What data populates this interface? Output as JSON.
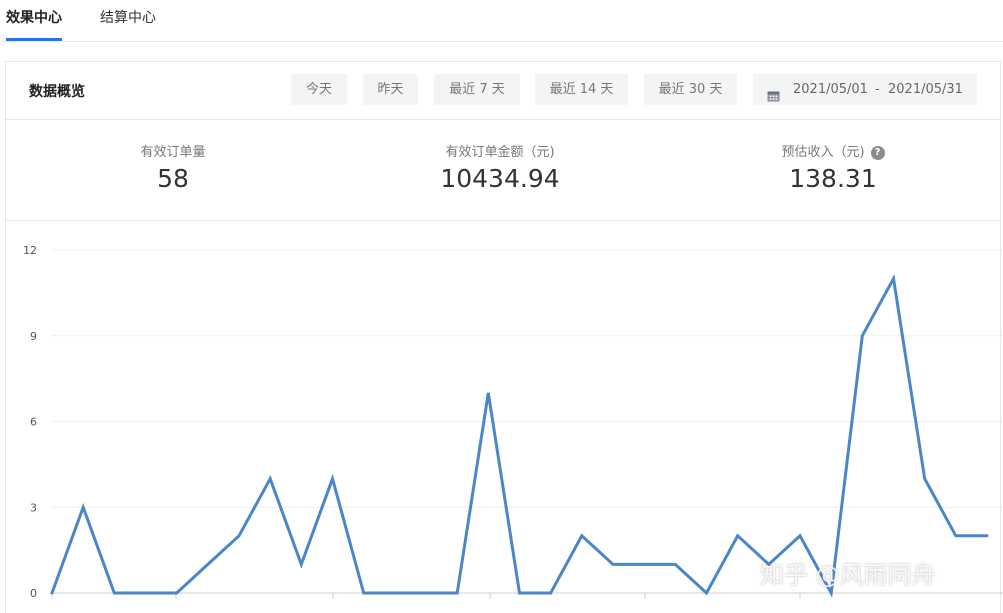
{
  "tabs": [
    {
      "label": "效果中心",
      "active": true
    },
    {
      "label": "结算中心",
      "active": false
    }
  ],
  "overview": {
    "title": "数据概览",
    "ranges": [
      "今天",
      "昨天",
      "最近 7 天",
      "最近 14 天",
      "最近 30 天"
    ],
    "date_range": {
      "icon": "calendar-icon",
      "start": "2021/05/01",
      "separator": "-",
      "end": "2021/05/31"
    }
  },
  "metrics": [
    {
      "label": "有效订单量",
      "value": "58"
    },
    {
      "label": "有效订单金额（元)",
      "value": "10434.94"
    },
    {
      "label": "预估收入（元)",
      "value": "138.31",
      "help_icon": "question-circle-icon",
      "help_glyph": "?"
    }
  ],
  "chart_data": {
    "type": "line",
    "x": [
      1,
      2,
      3,
      4,
      5,
      6,
      7,
      8,
      9,
      10,
      11,
      12,
      13,
      14,
      15,
      16,
      17,
      18,
      19,
      20,
      21,
      22,
      23,
      24,
      25,
      26,
      27,
      28,
      29,
      30,
      31
    ],
    "series": [
      {
        "values": [
          0,
          3,
          0,
          0,
          0,
          1,
          2,
          4,
          1,
          4,
          0,
          0,
          0,
          0,
          7,
          0,
          0,
          2,
          1,
          1,
          1,
          0,
          2,
          1,
          2,
          0,
          9,
          11,
          4,
          2,
          2
        ]
      }
    ],
    "yticks": [
      "0",
      "3",
      "6",
      "9",
      "12"
    ],
    "ylim": [
      0,
      12
    ],
    "grid": true,
    "color": "#4a86c8"
  },
  "watermark": "知乎 @风雨同舟"
}
